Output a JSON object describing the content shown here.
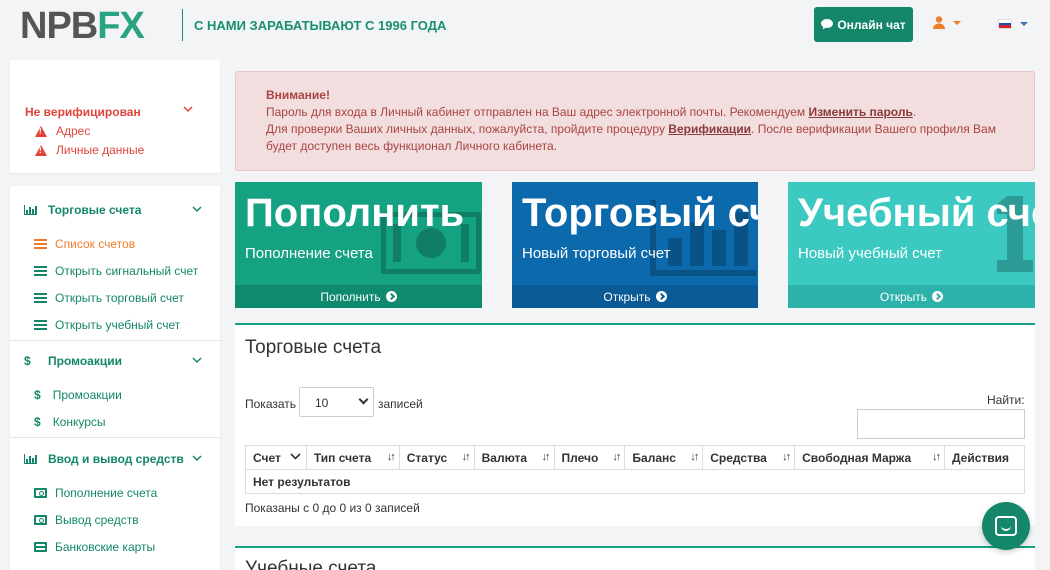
{
  "header": {
    "logo_prefix": "NPB",
    "logo_fx": "FX",
    "tagline": "С НАМИ ЗАРАБАТЫВАЮТ С 1996 ГОДА",
    "chat_label": "Онлайн чат",
    "icons": [
      "chat-icon",
      "user-icon",
      "flag-ru-icon"
    ],
    "colors": {
      "brand": "#14876a",
      "accent": "#f07c2a"
    }
  },
  "verification": {
    "title": "Не верифицирован",
    "items": [
      "Адрес",
      "Личные данные"
    ]
  },
  "sidebar": {
    "sections": [
      {
        "label": "Торговые счета",
        "items": [
          "Список счетов",
          "Открыть сигнальный счет",
          "Открыть торговый счет",
          "Открыть учебный счет"
        ]
      },
      {
        "label": "Промоакции",
        "items": [
          "Промоакции",
          "Конкурсы"
        ]
      },
      {
        "label": "Ввод и вывод средств",
        "items": [
          "Пополнение счета",
          "Вывод средств",
          "Банковские карты"
        ]
      }
    ]
  },
  "alert": {
    "title": "Внимание!",
    "line1_text": "Пароль для входа в Личный кабинет отправлен на Ваш адрес электронной почты. Рекомендуем ",
    "line1_link": "Изменить пароль",
    "line1_end": ".",
    "line2_text": "Для проверки Ваших личных данных, пожалуйста, пройдите процедуру ",
    "line2_link": "Верификации",
    "line2_end": ". После верификации Вашего профиля Вам",
    "line3_text": "будет доступен весь функционал Личного кабинета."
  },
  "actions": [
    {
      "big": "Пополнить",
      "sub": "Пополнение счета",
      "footer": "Пополнить",
      "color": "#15a283"
    },
    {
      "big": "Торговый счет",
      "sub": "Новый торговый счет",
      "footer": "Открыть",
      "color": "#0c6aac"
    },
    {
      "big": "Учебный счет",
      "sub": "Новый учебный счет",
      "footer": "Открыть",
      "color": "#3cc9c1"
    }
  ],
  "trading": {
    "title": "Торговые счета",
    "show_label": "Показать",
    "page_size": "10",
    "records_label": "записей",
    "search_label": "Найти:",
    "columns": [
      "Счет",
      "Тип счета",
      "Статус",
      "Валюта",
      "Плечо",
      "Баланс",
      "Средства",
      "Свободная Маржа",
      "Действия"
    ],
    "empty": "Нет результатов",
    "info": "Показаны с 0 до 0 из 0 записей"
  },
  "edu": {
    "title": "Учебные счета"
  }
}
